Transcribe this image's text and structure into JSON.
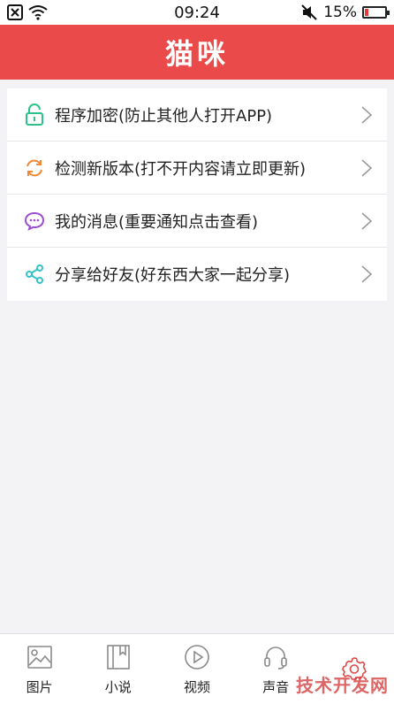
{
  "status_bar": {
    "time": "09:24",
    "battery_percent": "15%",
    "battery_level": 0.15
  },
  "header": {
    "title": "猫咪",
    "background_color": "#ea4a4a"
  },
  "menu": {
    "items": [
      {
        "label": "程序加密(防止其他人打开APP)",
        "icon": "lock-icon",
        "icon_color": "#2ec28b"
      },
      {
        "label": "检测新版本(打不开内容请立即更新)",
        "icon": "refresh-icon",
        "icon_color": "#f08a3a"
      },
      {
        "label": "我的消息(重要通知点击查看)",
        "icon": "message-icon",
        "icon_color": "#9b4fd1"
      },
      {
        "label": "分享给好友(好东西大家一起分享)",
        "icon": "share-icon",
        "icon_color": "#33c3c9"
      }
    ]
  },
  "bottom_nav": {
    "items": [
      {
        "label": "图片",
        "icon": "image-icon"
      },
      {
        "label": "小说",
        "icon": "book-icon"
      },
      {
        "label": "视频",
        "icon": "play-icon"
      },
      {
        "label": "声音",
        "icon": "headphones-icon"
      },
      {
        "label": "设置",
        "icon": "gear-icon",
        "active": true
      }
    ],
    "active_color": "#e04848"
  },
  "watermark": "技术开发网"
}
